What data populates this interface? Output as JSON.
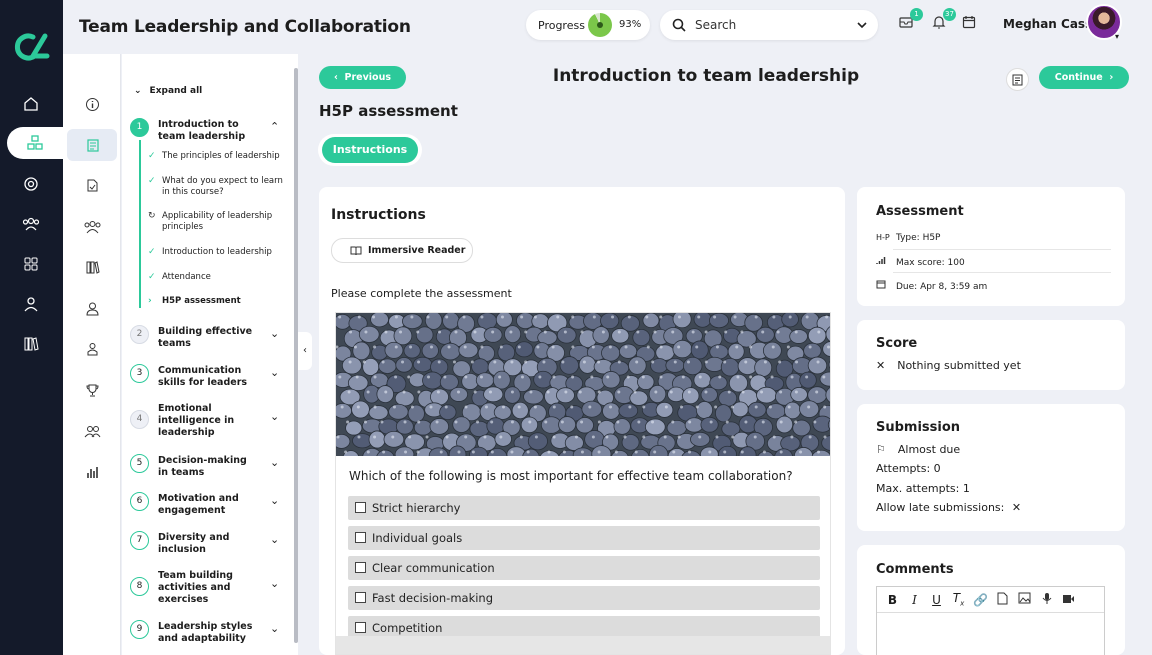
{
  "app": {
    "title": "Team Leadership and Collaboration"
  },
  "colors": {
    "accent": "#2cc99a",
    "nav_bg": "#141a2a",
    "page_bg": "#eef0f6"
  },
  "header": {
    "progress_label": "Progress",
    "progress_value": "93%",
    "progress_fraction": 0.93,
    "search_placeholder": "Search",
    "messages_badge": "1",
    "notifications_badge": "37",
    "user_name": "Meghan Cass"
  },
  "nav": {
    "icons": [
      "home-icon",
      "modules-icon",
      "target-icon",
      "people-icon",
      "apps-grid-icon",
      "profile-icon",
      "library-icon"
    ]
  },
  "outline": {
    "expand_all": "Expand all",
    "sections": [
      {
        "num": "1",
        "title": "Introduction to team leadership",
        "state": "current"
      },
      {
        "num": "2",
        "title": "Building effective teams",
        "state": "grey"
      },
      {
        "num": "3",
        "title": "Communication skills for leaders",
        "state": "open"
      },
      {
        "num": "4",
        "title": "Emotional intelligence in leadership",
        "state": "grey"
      },
      {
        "num": "5",
        "title": "Decision-making in teams",
        "state": "open"
      },
      {
        "num": "6",
        "title": "Motivation and engagement",
        "state": "open"
      },
      {
        "num": "7",
        "title": "Diversity and inclusion",
        "state": "open"
      },
      {
        "num": "8",
        "title": "Team building activities and exercises",
        "state": "open"
      },
      {
        "num": "9",
        "title": "Leadership styles and adaptability",
        "state": "open"
      }
    ],
    "subitems": [
      {
        "label": "The principles of leadership",
        "mark": "✓"
      },
      {
        "label": "What do you expect to learn in this course?",
        "mark": "✓"
      },
      {
        "label": "Applicability of leadership principles",
        "mark": "↻"
      },
      {
        "label": "Introduction to leadership",
        "mark": "✓"
      },
      {
        "label": "Attendance",
        "mark": "✓"
      },
      {
        "label": "H5P assessment",
        "mark": "›"
      }
    ]
  },
  "page": {
    "previous": "Previous",
    "continue": "Continue",
    "title": "Introduction to team leadership",
    "subtitle": "H5P assessment",
    "tab": "Instructions"
  },
  "instructions": {
    "heading": "Instructions",
    "immersive_reader": "Immersive Reader",
    "text": "Please complete the assessment",
    "question": "Which of the following is most important for effective team collaboration?",
    "options": [
      "Strict hierarchy",
      "Individual goals",
      "Clear communication",
      "Fast decision-making",
      "Competition"
    ]
  },
  "assessment": {
    "heading": "Assessment",
    "type_icon": "H-P",
    "type": "Type: H5P",
    "max_score": "Max score: 100",
    "due": "Due: Apr 8, 3:59 am"
  },
  "score": {
    "heading": "Score",
    "status": "Nothing submitted yet"
  },
  "submission": {
    "heading": "Submission",
    "status": "Almost due",
    "attempts": "Attempts: 0",
    "max_attempts": "Max. attempts: 1",
    "late": "Allow late submissions:"
  },
  "comments": {
    "heading": "Comments"
  }
}
